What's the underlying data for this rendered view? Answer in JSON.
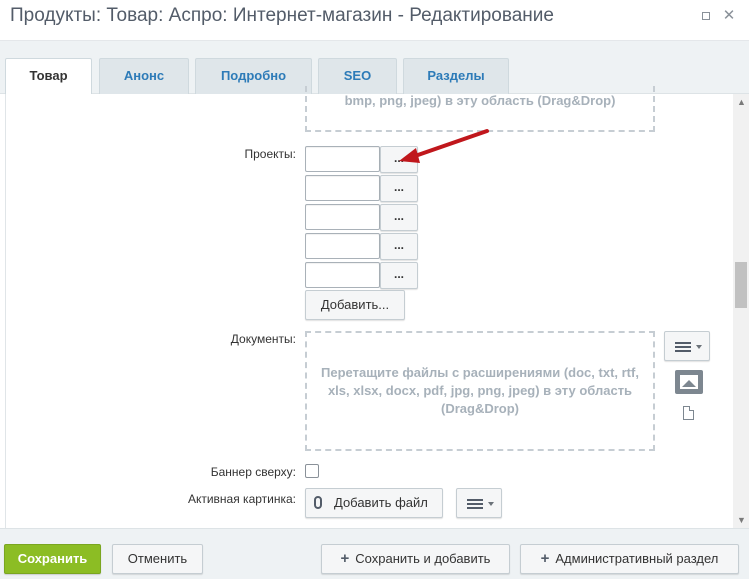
{
  "window": {
    "title": "Продукты: Товар: Аспро: Интернет-магазин - Редактирование",
    "maximize_icon": "maximize-icon",
    "close_icon": "close-icon"
  },
  "tabs": [
    {
      "label": "Товар",
      "active": true
    },
    {
      "label": "Анонс",
      "active": false
    },
    {
      "label": "Подробно",
      "active": false
    },
    {
      "label": "SEO",
      "active": false
    },
    {
      "label": "Разделы",
      "active": false
    }
  ],
  "images_dropzone": {
    "text": "bmp, png, jpeg) в эту область (Drag&Drop)"
  },
  "projects": {
    "label": "Проекты:",
    "fields": [
      "",
      "",
      "",
      "",
      ""
    ],
    "browse_label": "...",
    "add_label": "Добавить..."
  },
  "documents": {
    "label": "Документы:",
    "dropzone_text": "Перетащите файлы с расширениями (doc, txt, rtf, xls, xlsx, docx, pdf, jpg, png, jpeg) в эту область (Drag&Drop)",
    "menu_icon": "hamburger-menu-icon",
    "image_icon": "image-icon",
    "file_icon": "file-icon"
  },
  "banner": {
    "label": "Баннер сверху:",
    "checked": false
  },
  "active_picture": {
    "label": "Активная картинка:",
    "add_file_label": "Добавить файл",
    "clip_icon": "paperclip-icon",
    "menu_icon": "hamburger-menu-icon"
  },
  "footer": {
    "save_label": "Сохранить",
    "cancel_label": "Отменить",
    "save_add_label": "Сохранить и добавить",
    "admin_label": "Административный раздел"
  },
  "colors": {
    "save_button": "#8cbd24",
    "tab_text": "#2d7bb8",
    "annotation_arrow": "#c0171c"
  }
}
